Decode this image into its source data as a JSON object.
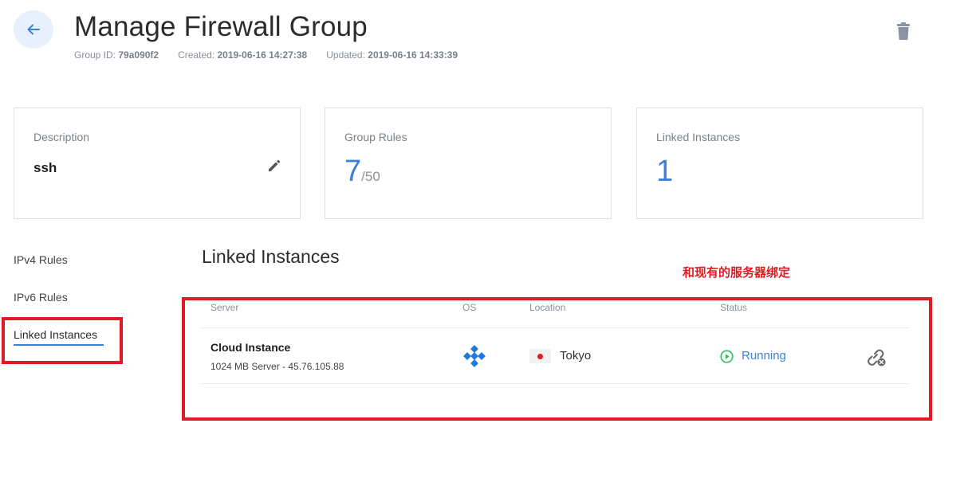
{
  "header": {
    "title": "Manage Firewall Group",
    "group_id_label": "Group ID:",
    "group_id": "79a090f2",
    "created_label": "Created:",
    "created": "2019-06-16 14:27:38",
    "updated_label": "Updated:",
    "updated": "2019-06-16 14:33:39"
  },
  "cards": {
    "description": {
      "label": "Description",
      "value": "ssh"
    },
    "group_rules": {
      "label": "Group Rules",
      "value": "7",
      "max": "/50"
    },
    "linked_instances": {
      "label": "Linked Instances",
      "value": "1"
    }
  },
  "left_menu": {
    "items": [
      {
        "label": "IPv4 Rules"
      },
      {
        "label": "IPv6 Rules"
      },
      {
        "label": "Linked Instances"
      }
    ],
    "active": "Linked Instances"
  },
  "section": {
    "title": "Linked Instances",
    "annotation": "和现有的服务器绑定"
  },
  "table": {
    "headers": [
      "Server",
      "OS",
      "Location",
      "Status"
    ],
    "rows": [
      {
        "server_name": "Cloud Instance",
        "server_sub": "1024 MB Server - 45.76.105.88",
        "os_icon": "os-logo-icon",
        "location": "Tokyo",
        "status": "Running"
      }
    ]
  },
  "colors": {
    "accent": "#3b82d6",
    "annotation_red": "#e01b24",
    "status_green": "#2bbf5a"
  }
}
